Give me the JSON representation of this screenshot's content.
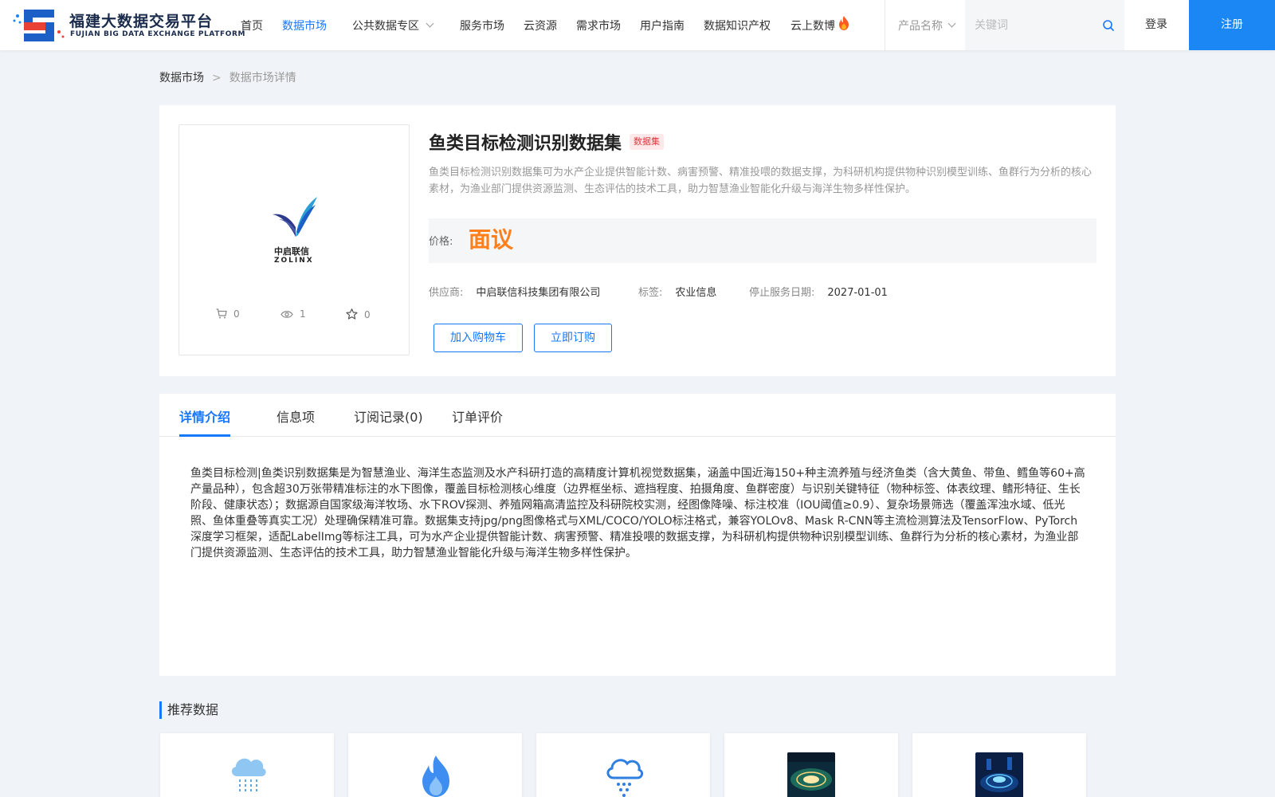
{
  "header": {
    "logo_title": "福建大数据交易平台",
    "logo_subtitle": "FUJIAN BIG DATA EXCHANGE  PLATFORM",
    "nav": [
      {
        "label": "首页",
        "active": false
      },
      {
        "label": "数据市场",
        "active": true
      },
      {
        "label": "公共数据专区",
        "active": false,
        "dropdown": true
      },
      {
        "label": "服务市场",
        "active": false
      },
      {
        "label": "云资源",
        "active": false
      },
      {
        "label": "需求市场",
        "active": false
      },
      {
        "label": "用户指南",
        "active": false
      },
      {
        "label": "数据知识产权",
        "active": false
      },
      {
        "label": "云上数博",
        "active": false,
        "icon": "fire-icon"
      }
    ],
    "search": {
      "category": "产品名称",
      "placeholder": "关键词"
    },
    "login_label": "登录",
    "register_label": "注册"
  },
  "breadcrumb": {
    "home": "数据市场",
    "separator": ">",
    "current": "数据市场详情"
  },
  "product": {
    "title": "鱼类目标检测识别数据集",
    "badge": "数据集",
    "description": "鱼类目标检测识别数据集可为水产企业提供智能计数、病害预警、精准投喂的数据支撑，为科研机构提供物种识别模型训练、鱼群行为分析的核心素材，为渔业部门提供资源监测、生态评估的技术工具，助力智慧渔业智能化升级与海洋生物多样性保护。",
    "price_label": "价格:",
    "price_value": "面议",
    "supplier_label": "供应商:",
    "supplier": "中启联信科技集团有限公司",
    "tag_label": "标签:",
    "tag": "农业信息",
    "end_date_label": "停止服务日期:",
    "end_date": "2027-01-01",
    "add_cart_label": "加入购物车",
    "subscribe_label": "立即订购",
    "brand_cn": "中启联信",
    "brand_en": "ZOLINX",
    "stats": {
      "cart": "0",
      "views": "1",
      "favorites": "0"
    }
  },
  "tabs": [
    {
      "label": "详情介绍",
      "active": true
    },
    {
      "label": "信息项",
      "active": false
    },
    {
      "label": "订阅记录(0)",
      "active": false
    },
    {
      "label": "订单评价",
      "active": false
    }
  ],
  "detail_text": "鱼类目标检测|鱼类识别数据集是为智慧渔业、海洋生态监测及水产科研打造的高精度计算机视觉数据集，涵盖中国近海150+种主流养殖与经济鱼类（含大黄鱼、带鱼、鳕鱼等60+高产量品种），包含超30万张带精准标注的水下图像，覆盖目标检测核心维度（边界框坐标、遮挡程度、拍摄角度、鱼群密度）与识别关键特征（物种标签、体表纹理、鳍形特征、生长阶段、健康状态）；数据源自国家级海洋牧场、水下ROV探测、养殖网箱高清监控及科研院校实测，经图像降噪、标注校准（IOU阈值≥0.9）、复杂场景筛选（覆盖浑浊水域、低光照、鱼体重叠等真实工况）处理确保精准可靠。数据集支持jpg/png图像格式与XML/COCO/YOLO标注格式，兼容YOLOv8、Mask R-CNN等主流检测算法及TensorFlow、PyTorch深度学习框架，适配LabelImg等标注工具，可为水产企业提供智能计数、病害预警、精准投喂的数据支撑，为科研机构提供物种识别模型训练、鱼群行为分析的核心素材，为渔业部门提供资源监测、生态评估的技术工具，助力智慧渔业智能化升级与海洋生物多样性保护。",
  "recommend": {
    "title": "推荐数据",
    "cards": [
      {
        "icon": "cloud-rain-icon"
      },
      {
        "icon": "flame-icon"
      },
      {
        "icon": "cloud-snow-icon"
      },
      {
        "icon": "city-night-image"
      },
      {
        "icon": "tech-platform-image"
      }
    ]
  },
  "colors": {
    "accent": "#1677ff",
    "price": "#ff7f1a",
    "badge_bg": "#fde9e9",
    "badge_text": "#e0383e",
    "register_bg": "#1b87f5"
  }
}
